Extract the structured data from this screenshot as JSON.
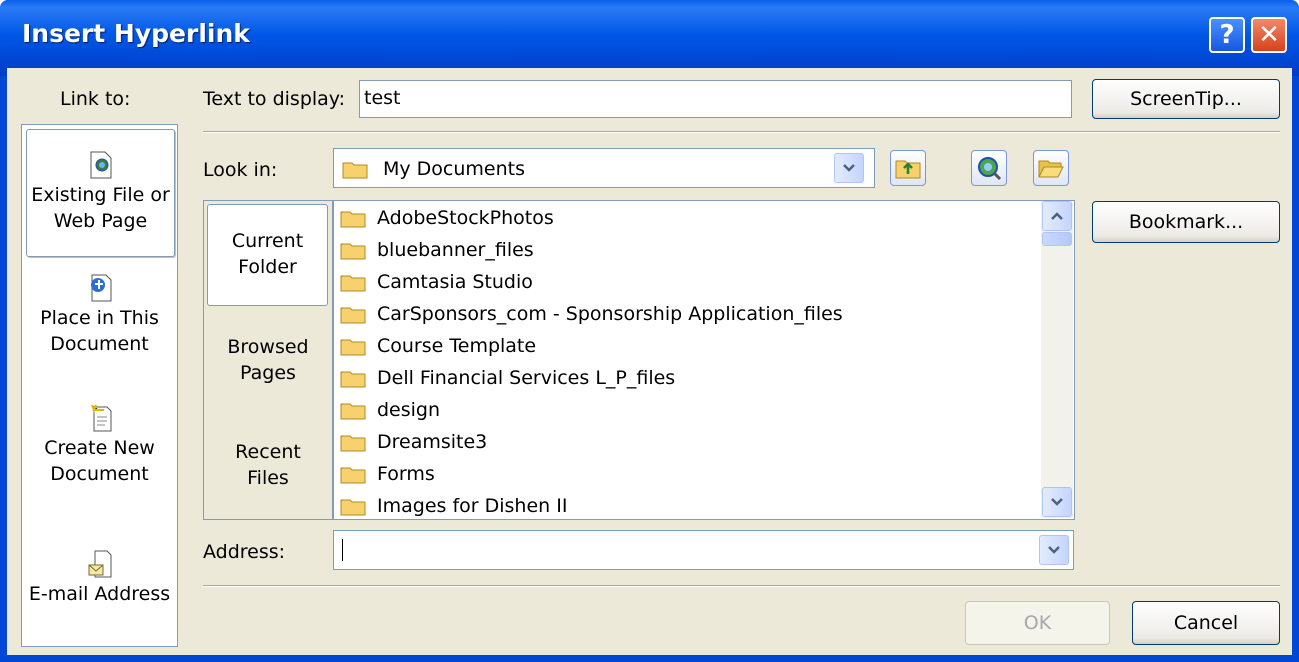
{
  "window": {
    "title": "Insert Hyperlink",
    "help_label": "?",
    "close_label": "✕"
  },
  "link_to": {
    "label": "Link to:",
    "items": [
      {
        "line1": "Existing File or",
        "line2": "Web Page",
        "icon": "existing-file-icon"
      },
      {
        "line1": "Place in This",
        "line2": "Document",
        "icon": "place-in-document-icon"
      },
      {
        "line1": "Create New",
        "line2": "Document",
        "icon": "create-new-document-icon"
      },
      {
        "line1": "E-mail Address",
        "line2": "",
        "icon": "email-address-icon"
      }
    ]
  },
  "text_to_display": {
    "label": "Text to display:",
    "value": "test"
  },
  "screentip_label": "ScreenTip...",
  "look_in": {
    "label": "Look in:",
    "value": "My Documents"
  },
  "look_sections": [
    {
      "line1": "Current",
      "line2": "Folder"
    },
    {
      "line1": "Browsed",
      "line2": "Pages"
    },
    {
      "line1": "Recent",
      "line2": "Files"
    }
  ],
  "files": [
    "AdobeStockPhotos",
    "bluebanner_files",
    "Camtasia Studio",
    "CarSponsors_com - Sponsorship Application_files",
    "Course Template",
    "Dell Financial Services L_P_files",
    "design",
    "Dreamsite3",
    "Forms",
    "Images for Dishen II"
  ],
  "bookmark_label": "Bookmark...",
  "address": {
    "label": "Address:",
    "value": ""
  },
  "ok_label": "OK",
  "cancel_label": "Cancel",
  "colors": {
    "title_bar": "#0058e6",
    "dialog_bg": "#ece9d8",
    "border": "#7f9db9",
    "close_button": "#d8401c"
  }
}
